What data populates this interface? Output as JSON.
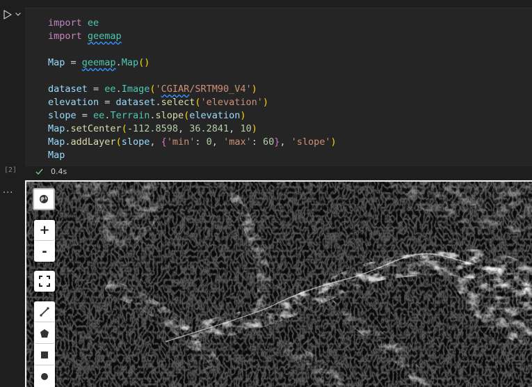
{
  "notebook": {
    "execution_count": "[2]",
    "status": {
      "duration": "0.4s"
    },
    "more_actions": "..."
  },
  "code_lines": [
    "import ee",
    "import geemap",
    "",
    "Map = geemap.Map()",
    "",
    "dataset = ee.Image('CGIAR/SRTM90_V4')",
    "elevation = dataset.select('elevation')",
    "slope = ee.Terrain.slope(elevation)",
    "Map.setCenter(-112.8598, 36.2841, 10)",
    "Map.addLayer(slope, {'min': 0, 'max': 60}, 'slope')",
    "Map"
  ],
  "map": {
    "layer": "slope",
    "colors": {
      "background": "#0a0a0a",
      "relief": "#ffffff"
    },
    "controls": [
      {
        "name": "basemap-button",
        "icon": "globe-icon"
      },
      {
        "name": "zoom-in-button",
        "label": "+"
      },
      {
        "name": "zoom-out-button",
        "label": "-"
      },
      {
        "name": "fullscreen-button",
        "icon": "fullscreen-icon"
      },
      {
        "name": "draw-polyline-button",
        "icon": "polyline-icon"
      },
      {
        "name": "draw-polygon-button",
        "icon": "polygon-icon"
      },
      {
        "name": "draw-rectangle-button",
        "icon": "rectangle-icon"
      },
      {
        "name": "draw-circle-button",
        "icon": "circle-icon"
      }
    ]
  }
}
